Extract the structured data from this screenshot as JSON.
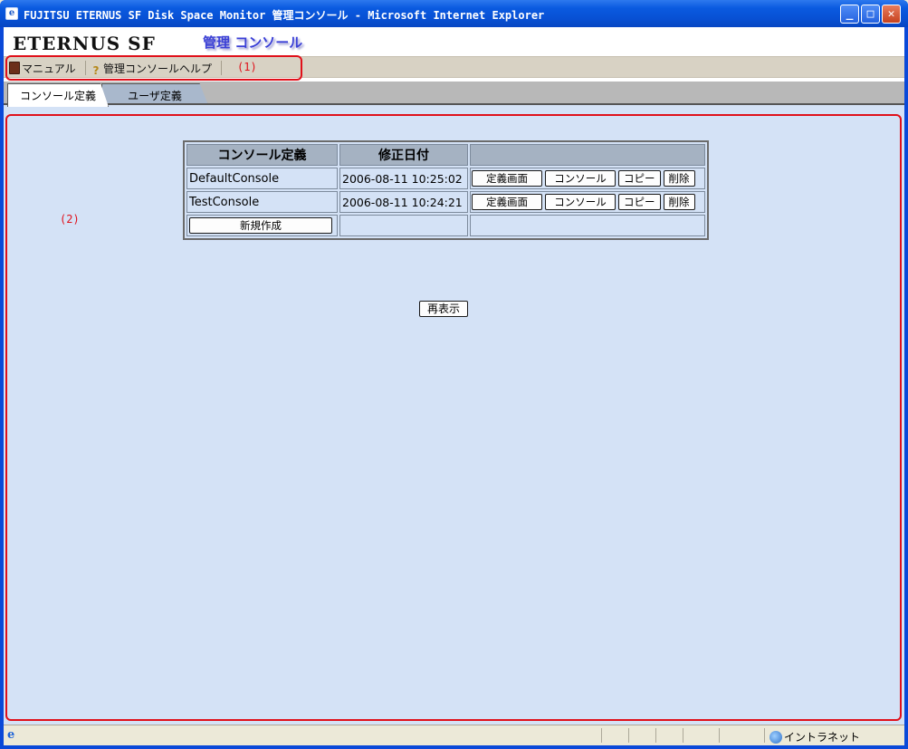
{
  "window": {
    "title": "FUJITSU ETERNUS SF Disk Space Monitor 管理コンソール - Microsoft Internet Explorer",
    "minimize_glyph": "_",
    "maximize_glyph": "□",
    "close_glyph": "✕"
  },
  "header": {
    "logo": "ETERNUS SF",
    "console_title": "管理 コンソール"
  },
  "toolbar": {
    "manual_label": "マニュアル",
    "help_label": "管理コンソールヘルプ",
    "help_glyph": "?",
    "annotation": "(1)"
  },
  "tabs": [
    {
      "label": "コンソール定義",
      "active": true
    },
    {
      "label": "ユーザ定義",
      "active": false
    }
  ],
  "main": {
    "annotation": "(2)",
    "table": {
      "headers": [
        "コンソール定義",
        "修正日付",
        ""
      ],
      "rows": [
        {
          "name": "DefaultConsole",
          "date": "2006-08-11 10:25:02"
        },
        {
          "name": "TestConsole",
          "date": "2006-08-11 10:24:21"
        }
      ],
      "row_buttons": {
        "define_screen": "定義画面",
        "console": "コンソール",
        "copy": "コピー",
        "delete": "削除"
      },
      "new_button": "新規作成"
    },
    "refresh_button": "再表示"
  },
  "statusbar": {
    "zone": "イントラネット"
  },
  "colors": {
    "annotation_red": "#e0101a",
    "content_bg": "#d4e2f6",
    "header_cell": "#a5b2c2",
    "title_blue": "#3a3fd6"
  }
}
